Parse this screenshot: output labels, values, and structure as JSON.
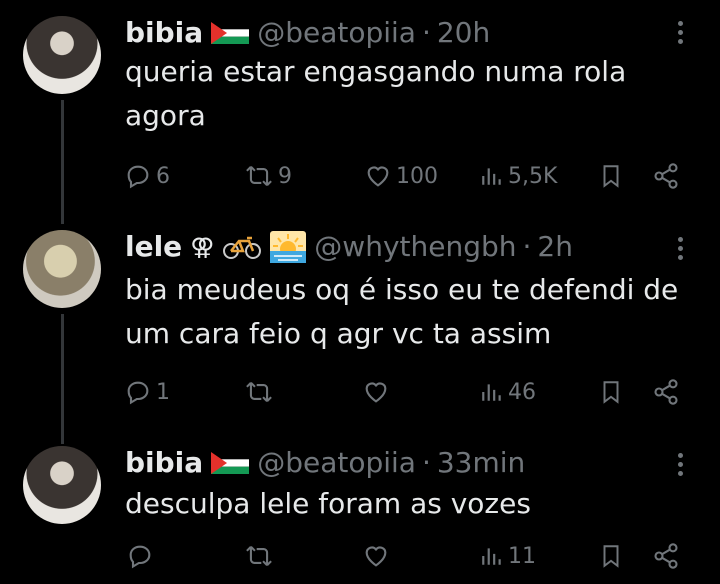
{
  "tweets": [
    {
      "name": "bibia",
      "handle": "@beatopiia",
      "separator": "·",
      "time": "20h",
      "text": "queria estar engasgando numa rola agora",
      "replies": "6",
      "retweets": "9",
      "likes": "100",
      "views": "5,5K"
    },
    {
      "name": "lele",
      "name_symbol": "⚢",
      "handle": "@whythengbh",
      "separator": "·",
      "time": "2h",
      "text": "bia meudeus oq é isso eu te defendi de um cara feio q agr vc ta assim",
      "replies": "1",
      "retweets": "",
      "likes": "",
      "views": "46"
    },
    {
      "name": "bibia",
      "handle": "@beatopiia",
      "separator": "·",
      "time": "33min",
      "text": "desculpa lele foram as vozes",
      "replies": "",
      "retweets": "",
      "likes": "",
      "views": "11"
    }
  ],
  "icons": {
    "reply": "reply-icon",
    "retweet": "retweet-icon",
    "like": "heart-icon",
    "views": "views-icon",
    "bookmark": "bookmark-icon",
    "share": "share-icon",
    "more": "more-icon",
    "flag": "palestine-flag-icon",
    "bicycle": "bicycle-icon",
    "sunrise": "sunrise-icon"
  },
  "colors": {
    "background": "#000000",
    "text": "#e7e9ea",
    "secondary": "#71767b",
    "thread_line": "#333639"
  }
}
